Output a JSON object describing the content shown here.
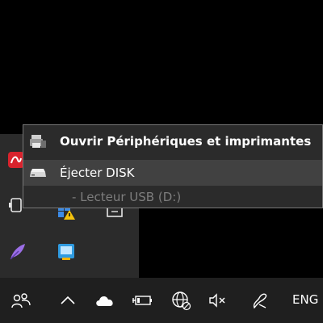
{
  "context_menu": {
    "items": [
      {
        "label": "Ouvrir Périphériques et imprimantes",
        "icon": "printer-device-icon",
        "style": "bold"
      },
      {
        "label": "Éjecter DISK",
        "icon": "drive-icon",
        "state": "highlighted"
      },
      {
        "label": "- Lecteur USB (D:)",
        "state": "disabled"
      }
    ]
  },
  "tray_overflow": {
    "icons": [
      "red-app-icon",
      "usb-device-icon",
      "windows-shield-warning-icon",
      "monitor-icon",
      "purple-feather-icon",
      "blue-app-icon"
    ]
  },
  "taskbar": {
    "icons": [
      "people-icon",
      "chevron-up-icon",
      "onedrive-cloud-icon",
      "battery-plug-icon",
      "network-globe-icon",
      "speaker-muted-icon",
      "pen-icon"
    ],
    "language": "ENG"
  },
  "colors": {
    "menu_background": "#2b2b2b",
    "menu_border": "#777777",
    "highlight": "#414141",
    "taskbar": "#1f1f1f",
    "disabled_text": "#7d7d7d"
  }
}
